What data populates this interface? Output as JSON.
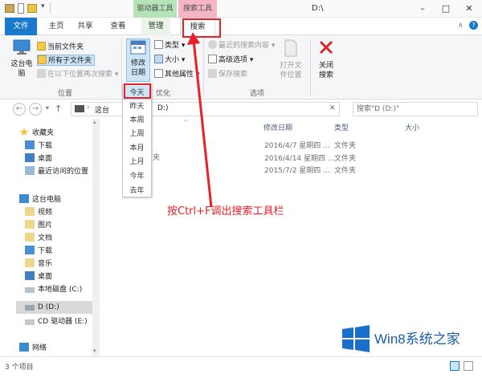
{
  "window": {
    "title": "D:\\"
  },
  "context_tabs": {
    "drive_tools": "驱动器工具",
    "search_tools": "搜索工具"
  },
  "tabs": [
    "文件",
    "主页",
    "共享",
    "查看",
    "管理",
    "搜索"
  ],
  "ribbon": {
    "location": {
      "big_button": "这台电脑",
      "current_folder": "当前文件夹",
      "all_subfolders": "所有子文件夹",
      "search_again": "在以下位置再次搜索",
      "label": "位置"
    },
    "refine": {
      "date_modified": "修改日期",
      "kind": "类型",
      "size": "大小",
      "other_properties": "其他属性",
      "label": "优化"
    },
    "options": {
      "recent_searches": "最近的搜索内容",
      "advanced_options": "高级选项",
      "save_search": "保存搜索",
      "open_location": "打开文件位置",
      "label": "选项"
    },
    "close": {
      "close_search": "关闭搜索"
    }
  },
  "date_dropdown": [
    "今天",
    "昨天",
    "本周",
    "上周",
    "本月",
    "上月",
    "今年",
    "去年"
  ],
  "address": {
    "path_visible": "这台",
    "path_tail": "D:)",
    "search_placeholder": "搜索\"D (D:)\""
  },
  "nav": {
    "favorites": "收藏夹",
    "downloads": "下载",
    "desktop": "桌面",
    "recent": "最近访问的位置",
    "this_pc": "这台电脑",
    "videos": "视频",
    "pictures": "图片",
    "documents": "文档",
    "downloads2": "下载",
    "music": "音乐",
    "desktop2": "桌面",
    "local_disk": "本地磁盘 (C:)",
    "d_drive": "D (D:)",
    "cd_drive": "CD 驱动器 (E:)",
    "network": "网络"
  },
  "columns": {
    "date_modified": "修改日期",
    "type": "类型",
    "size": "大小"
  },
  "rows": [
    {
      "name_tail": "夹",
      "date": "2016/4/7 星期四 ...",
      "type": "文件夹"
    },
    {
      "name_tail": "",
      "date": "2016/4/14 星期四 ...",
      "type": "文件夹"
    },
    {
      "name_tail": "",
      "date": "2015/7/2 星期四 ...",
      "type": "文件夹"
    }
  ],
  "status": {
    "count": "3 个项目"
  },
  "annotation": "按Ctrl+F调出搜索工具栏",
  "watermark": "Win8系统之家",
  "colors": {
    "accent": "#1979ca",
    "annotation": "#e8202a",
    "drive_tools_tab": "#b5e3b7",
    "search_tools_tab": "#f4b6c6"
  }
}
